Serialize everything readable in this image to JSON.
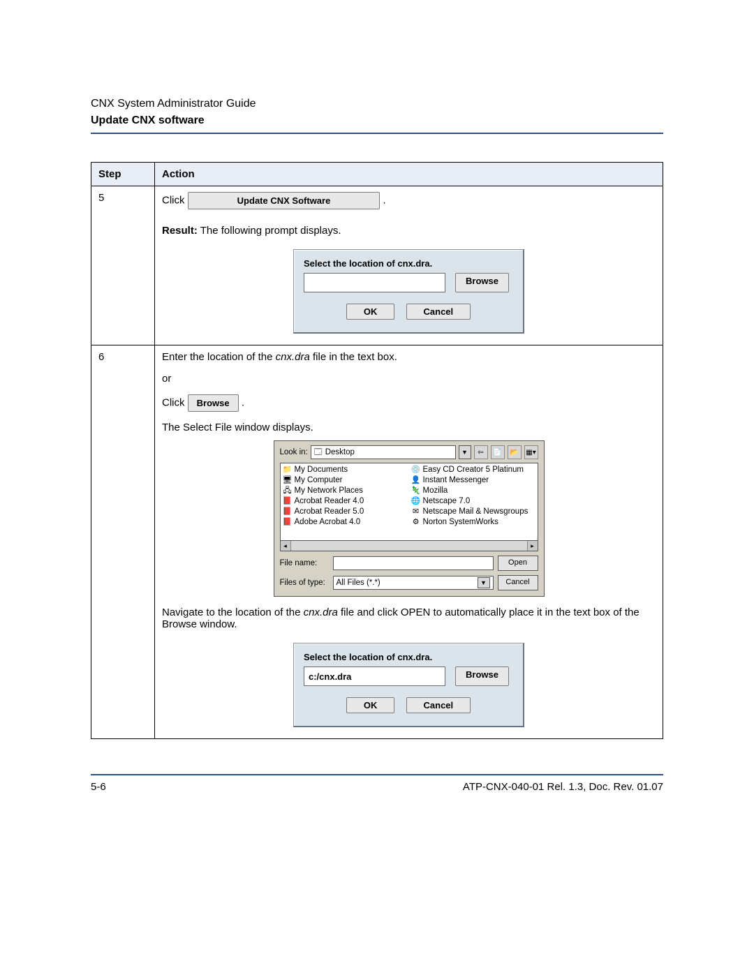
{
  "doc_header": "CNX System Administrator Guide",
  "page_title": "Update CNX software",
  "table": {
    "head_step": "Step",
    "head_action": "Action"
  },
  "step5": {
    "num": "5",
    "click": "Click",
    "update_btn": "Update CNX Software",
    "period": ".",
    "result_label": "Result:",
    "result_text": " The following prompt displays.",
    "prompt": {
      "title": "Select the location of cnx.dra.",
      "input_value": "",
      "browse": "Browse",
      "ok": "OK",
      "cancel": "Cancel"
    }
  },
  "step6": {
    "num": "6",
    "line1a": "Enter the location of the ",
    "line1_ital": "cnx.dra",
    "line1b": " file in the text box.",
    "or": "or",
    "click": "Click",
    "browse_btn": "Browse",
    "period": ".",
    "line3": "The Select File window displays.",
    "fs": {
      "lookin_label": "Look in:",
      "lookin_value": "Desktop",
      "items_left": [
        "My Documents",
        "My Computer",
        "My Network Places",
        "Acrobat Reader 4.0",
        "Acrobat Reader 5.0",
        "Adobe Acrobat 4.0"
      ],
      "items_right": [
        "Easy CD Creator 5 Platinum",
        "Instant Messenger",
        "Mozilla",
        "Netscape 7.0",
        "Netscape Mail & Newsgroups",
        "Norton SystemWorks"
      ],
      "filename_label": "File name:",
      "filename_value": "",
      "filetype_label": "Files of type:",
      "filetype_value": "All Files (*.*)",
      "open": "Open",
      "cancel": "Cancel"
    },
    "nav_a": "Navigate to the location of the ",
    "nav_ital": "cnx.dra",
    "nav_b": " file and click OPEN to automatically place it in the text box of the Browse window.",
    "prompt2": {
      "title": "Select the location of cnx.dra.",
      "input_value": "c:/cnx.dra",
      "browse": "Browse",
      "ok": "OK",
      "cancel": "Cancel"
    }
  },
  "footer": {
    "page": "5-6",
    "docinfo": "ATP-CNX-040-01 Rel. 1.3, Doc. Rev. 01.07"
  }
}
